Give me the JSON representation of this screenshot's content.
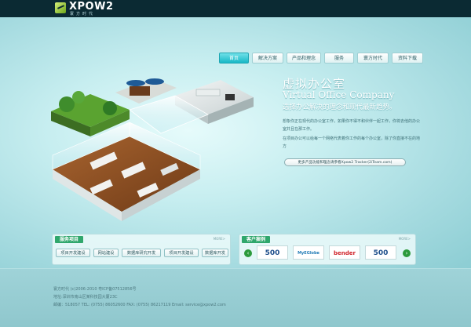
{
  "brand": {
    "name": "XPOW2",
    "subtitle": "寰方时代"
  },
  "nav": {
    "items": [
      {
        "label": "首页",
        "active": true
      },
      {
        "label": "解决方案",
        "active": false
      },
      {
        "label": "产品和理念",
        "active": false
      },
      {
        "label": "服务",
        "active": false
      },
      {
        "label": "寰方时代",
        "active": false
      },
      {
        "label": "资料下载",
        "active": false
      }
    ]
  },
  "hero": {
    "title": "虚拟办公室",
    "title_en": "Virtual Office Company",
    "tagline": "选择办公解决的理念和现代最新趋势。",
    "paragraph1": "想象你正在现代的办公室工作，如果你不得不和伙伴一起工作，你将去他的办公室并且在那工作。",
    "paragraph2": "在项目办公可以给每一个网络代表着你工作的每个办公室，除了你直接不在的地方",
    "more_label": "更多产品功能和理念请参看Xpow2 Tracker(2iTeam.com)"
  },
  "services": {
    "title": "服务项目",
    "more": "MORE>",
    "buttons": [
      "项目开发建设",
      "网站建设",
      "数据库研究开发",
      "项目开发建设",
      "数据库开发"
    ]
  },
  "clients": {
    "title": "客户案例",
    "more": "MORE>",
    "logos": [
      "500",
      "MyEGlobe",
      "bender",
      "500"
    ],
    "prev_icon": "arrow-left-icon",
    "next_icon": "arrow-right-icon"
  },
  "footer": {
    "line1": "寰方时代 (c)2006-2010 粤ICP备07512856号",
    "line2": "地址:深圳市南山区某科技园大厦23C",
    "line3": "邮编：518057 TEL: (0755) 86052600 FAX: (0755) 86217119 Email: service@xpow2.com"
  },
  "colors": {
    "topbar": "#0b2a33",
    "accent": "#17b8c6",
    "panel_title": "#2fa76c",
    "arrow": "#2c9a3c"
  }
}
